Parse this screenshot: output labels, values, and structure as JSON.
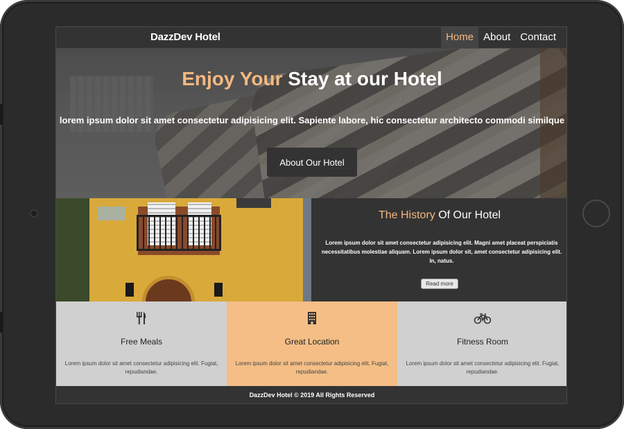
{
  "nav": {
    "brand": "DazzDev Hotel",
    "links": [
      {
        "label": "Home",
        "active": true
      },
      {
        "label": "About",
        "active": false
      },
      {
        "label": "Contact",
        "active": false
      }
    ]
  },
  "hero": {
    "title_accent": "Enjoy Your",
    "title_rest": "Stay at our Hotel",
    "subtitle": "lorem ipsum dolor sit amet consectetur adipisicing elit. Sapiente labore, hic consectetur architecto commodi similque",
    "button_label": "About Our Hotel"
  },
  "history": {
    "title_accent": "The History",
    "title_rest": "Of Our Hotel",
    "text": "Lorem ipsum dolor sit amet consectetur adipisicing elit. Magni amet placeat perspiciatis necessitatibus molestiae aliquam. Lorem ipsum dolor sit, amet consectetur adipisicing elit. In, natus.",
    "button_label": "Read more"
  },
  "features": [
    {
      "icon": "utensils-icon",
      "title": "Free Meals",
      "text": "Lorem ipsum dolor sit amet consectetur adipisicing elit. Fugiat, repudiandae."
    },
    {
      "icon": "building-icon",
      "title": "Great Location",
      "text": "Lorem ipsum dolor sit amet consectetur adipisicing elit. Fugiat, repudiandae."
    },
    {
      "icon": "bicycle-icon",
      "title": "Fitness Room",
      "text": "Lorem ipsum dolor sit amet consectetur adipisicing elit. Fugiat, repudiandae."
    }
  ],
  "footer": {
    "text": "DazzDev Hotel © 2019 All Rights Reserved"
  },
  "colors": {
    "accent": "#f4b880",
    "dark": "#333333",
    "feature_bg": "#d0d0d0",
    "feature_highlight": "#f4be86"
  }
}
